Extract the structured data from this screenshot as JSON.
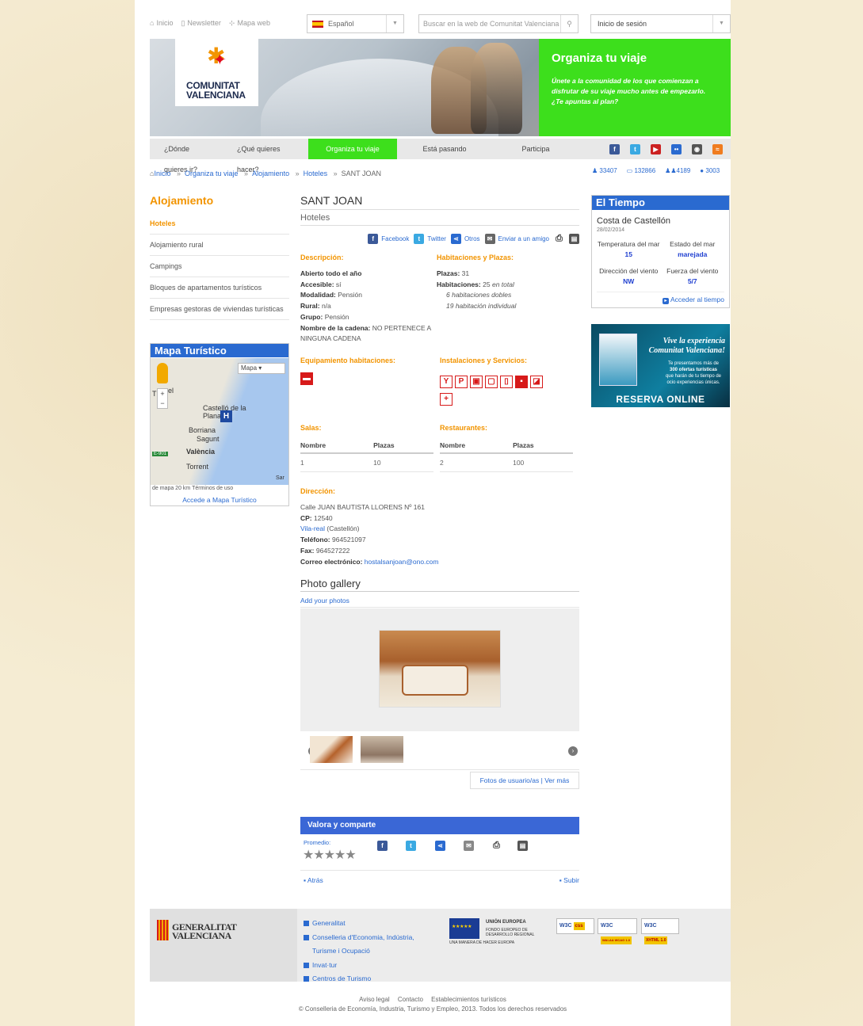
{
  "toplinks": [
    {
      "icon": "home-icon",
      "glyph": "⌂",
      "label": "Inicio"
    },
    {
      "icon": "newsletter-icon",
      "glyph": "▯",
      "label": "Newsletter"
    },
    {
      "icon": "sitemap-icon",
      "glyph": "⊹",
      "label": "Mapa web"
    }
  ],
  "language": {
    "selected": "Español"
  },
  "search": {
    "placeholder": "Buscar en la web de Comunitat Valenciana"
  },
  "login": {
    "label": "Inicio de sesión"
  },
  "logo": {
    "line1": "COMUNITAT",
    "line2": "VALENCIANA"
  },
  "promo": {
    "title": "Organiza tu viaje",
    "text": "Únete a la comunidad de los que comienzan a disfrutar de su viaje mucho antes de empezarlo. ¿Te apuntas al plan?"
  },
  "nav": {
    "items": [
      "¿Dónde quieres ir?",
      "¿Qué quieres hacer?",
      "Organiza tu viaje",
      "Está pasando",
      "Participa"
    ],
    "active_index": 2,
    "social": [
      {
        "name": "facebook-icon",
        "glyph": "f",
        "color": "#3b5998"
      },
      {
        "name": "twitter-icon",
        "glyph": "t",
        "color": "#3aa9e2"
      },
      {
        "name": "youtube-icon",
        "glyph": "▶",
        "color": "#cc2222"
      },
      {
        "name": "flickr-icon",
        "glyph": "••",
        "color": "#2a6ad0"
      },
      {
        "name": "instagram-icon",
        "glyph": "◉",
        "color": "#555555"
      },
      {
        "name": "rss-icon",
        "glyph": "≈",
        "color": "#f07c20"
      }
    ]
  },
  "breadcrumb": [
    "Inicio",
    "Organiza tu viaje",
    "Alojamiento",
    "Hoteles",
    "SANT JOAN"
  ],
  "stats": [
    {
      "icon": "users-icon",
      "glyph": "♟",
      "value": "33407"
    },
    {
      "icon": "cards-icon",
      "glyph": "▭",
      "value": "132866"
    },
    {
      "icon": "group-icon",
      "glyph": "♟♟",
      "value": "4189"
    },
    {
      "icon": "comments-icon",
      "glyph": "●",
      "value": "3003"
    }
  ],
  "left": {
    "title": "Alojamiento",
    "menu": [
      "Hoteles",
      "Alojamiento rural",
      "Campings",
      "Bloques de apartamentos turísticos",
      "Empresas gestoras de viviendas turísticas"
    ],
    "active_index": 0,
    "map": {
      "title": "Mapa Turístico",
      "type": "Mapa",
      "labels": [
        "Castelló de la Plana",
        "Borriana",
        "Sagunt",
        "València",
        "Torrent",
        "E-901",
        "Sar",
        "T",
        "el"
      ],
      "footer": "de mapa  20 km  Términos de uso",
      "link": "Accede a Mapa Turístico"
    }
  },
  "main": {
    "title": "SANT JOAN",
    "subtitle": "Hoteles",
    "share": [
      "Facebook",
      "Twitter",
      "Otros",
      "Enviar a un amigo"
    ],
    "descripcion": {
      "heading": "Descripción:",
      "rows": [
        {
          "k": "Abierto todo el año",
          "v": ""
        },
        {
          "k": "Accesible:",
          "v": "sí"
        },
        {
          "k": "Modalidad:",
          "v": "Pensión"
        },
        {
          "k": "Rural:",
          "v": "n/a"
        },
        {
          "k": "Grupo:",
          "v": "Pensión"
        },
        {
          "k": "Nombre de la cadena:",
          "v": "NO PERTENECE A NINGUNA CADENA"
        }
      ]
    },
    "habitaciones": {
      "heading": "Habitaciones y Plazas:",
      "plazas_k": "Plazas:",
      "plazas_v": "31",
      "hab_k": "Habitaciones:",
      "hab_v": "25",
      "hab_total": "en total",
      "dobles": "6 habitaciones dobles",
      "individual": "19 habitación individual"
    },
    "equipamiento": {
      "heading": "Equipamiento habitaciones:"
    },
    "instalaciones": {
      "heading": "Instalaciones y Servicios:"
    },
    "salas": {
      "heading": "Salas:",
      "cols": [
        "Nombre",
        "Plazas"
      ],
      "rows": [
        [
          "1",
          "10"
        ]
      ]
    },
    "restaurantes": {
      "heading": "Restaurantes:",
      "cols": [
        "Nombre",
        "Plazas"
      ],
      "rows": [
        [
          "2",
          "100"
        ]
      ]
    },
    "direccion": {
      "heading": "Dirección:",
      "street": "Calle JUAN BAUTISTA LLORENS Nº 161",
      "cp_k": "CP:",
      "cp_v": "12540",
      "town": "Vila-real",
      "province": "(Castellón)",
      "tel_k": "Teléfono:",
      "tel_v": "964521097",
      "fax_k": "Fax:",
      "fax_v": "964527222",
      "mail_k": "Correo electrónico:",
      "mail_v": "hostalsanjoan@ono.com"
    },
    "gallery": {
      "title": "Photo gallery",
      "add": "Add your photos",
      "link_users": "Fotos de usuario/as",
      "link_sep": "|",
      "link_more": "Ver más"
    },
    "valora": {
      "title": "Valora y comparte",
      "promedio": "Promedio:",
      "stars": "★★★★★"
    },
    "back": "Atrás",
    "up": "Subir"
  },
  "weather": {
    "title": "El Tiempo",
    "location": "Costa de Castellón",
    "date": "28/02/2014",
    "cells": [
      {
        "label": "Temperatura del mar",
        "value": "15"
      },
      {
        "label": "Estado del mar",
        "value": "marejada"
      },
      {
        "label": "Dirección del viento",
        "value": "NW"
      },
      {
        "label": "Fuerza del viento",
        "value": "5/7"
      }
    ],
    "link": "Acceder al tiempo"
  },
  "ad": {
    "line1": "Vive la experiencia",
    "line2": "Comunitat Valenciana!",
    "sub1": "Te presentamos más de",
    "sub2": "300 ofertas turísticas",
    "sub3": "que harán de tu tiempo de",
    "sub4": "ocio experiencias únicas.",
    "cta": "RESERVA ONLINE"
  },
  "footer": {
    "gv1": "GENERALITAT",
    "gv2": "VALENCIANA",
    "links": [
      "Generalitat",
      "Conselleria d'Economia, Indústria, Turisme i Ocupació",
      "Invat·tur",
      "Centros de Turismo"
    ],
    "eu": {
      "title": "UNIÓN EUROPEA",
      "fund1": "FONDO EUROPEO DE",
      "fund2": "DESARROLLO REGIONAL",
      "motto": "UNA MANERA DE HACER EUROPA"
    },
    "badges": [
      {
        "w3c": "W3C",
        "tag": "css"
      },
      {
        "w3c": "W3C",
        "tag": "WAI-AA WCAG 1.0"
      },
      {
        "w3c": "W3C",
        "tag": "XHTML 1.0"
      }
    ],
    "bottom_links": [
      "Aviso legal",
      "Contacto",
      "Establecimientos turísticos"
    ],
    "copyright": "© Conselleria de Economía, Industria, Turismo y Empleo, 2013. Todos los derechos reservados"
  }
}
